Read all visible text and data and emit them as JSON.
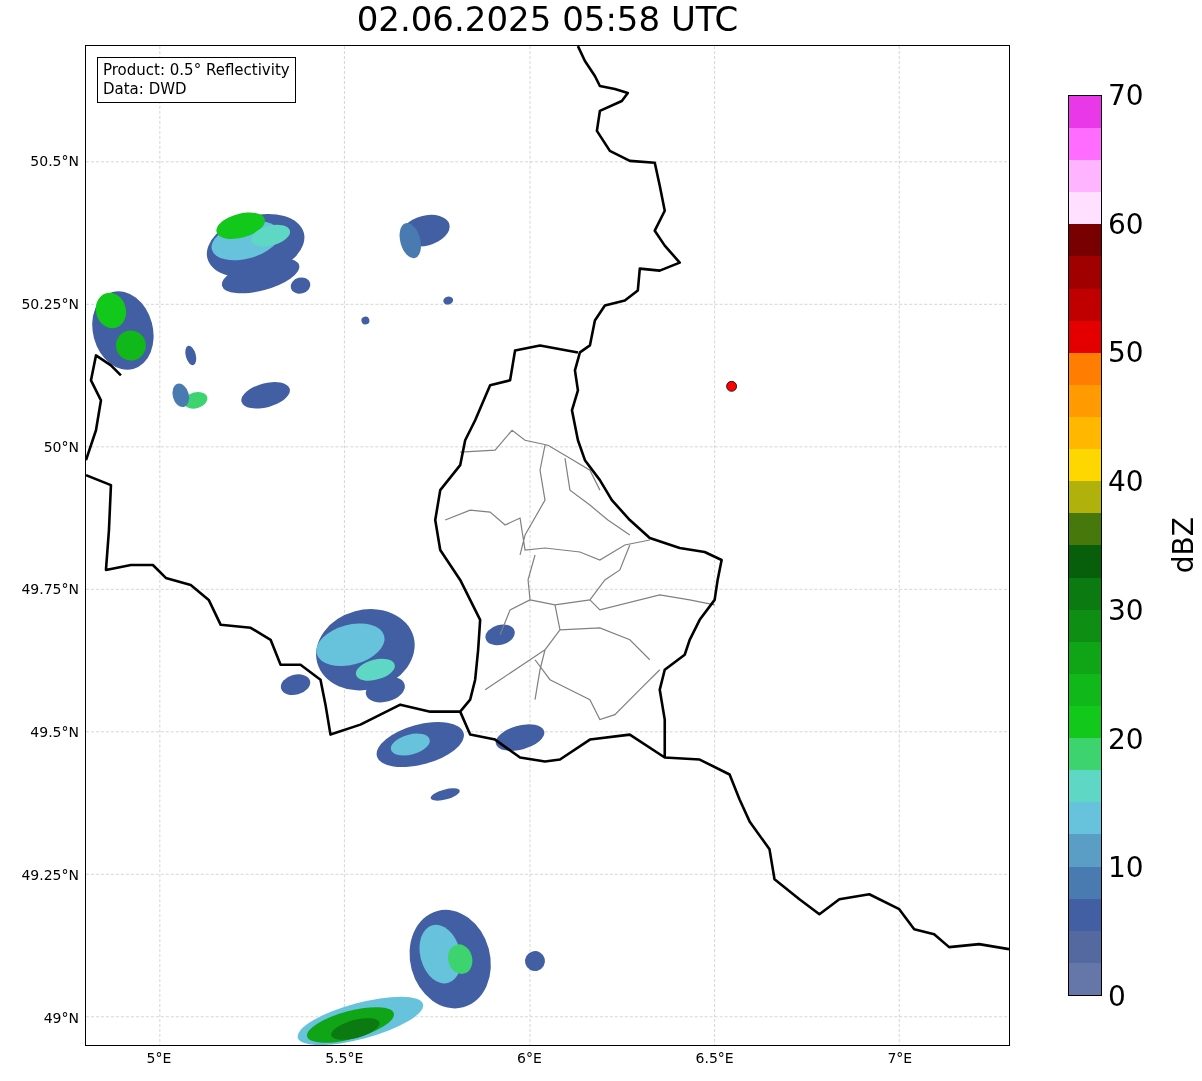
{
  "title": "02.06.2025 05:58 UTC",
  "map": {
    "legend": [
      "Product: 0.5° Reflectivity",
      "Data: DWD"
    ],
    "x_ticks": [
      "5°E",
      "5.5°E",
      "6°E",
      "6.5°E",
      "7°E"
    ],
    "y_ticks": [
      "50.5°N",
      "50.25°N",
      "50°N",
      "49.75°N",
      "49.5°N",
      "49.25°N",
      "49°N"
    ]
  },
  "colorbar": {
    "label": "dBZ",
    "ticks": [
      "70",
      "60",
      "50",
      "40",
      "30",
      "20",
      "10",
      "0"
    ],
    "segments": [
      {
        "color": "#6577a8"
      },
      {
        "color": "#54699f"
      },
      {
        "color": "#425fa3"
      },
      {
        "color": "#4a7bb0"
      },
      {
        "color": "#5a9ec6"
      },
      {
        "color": "#67c3dc"
      },
      {
        "color": "#5ed7c4"
      },
      {
        "color": "#3dd46f"
      },
      {
        "color": "#12c81a"
      },
      {
        "color": "#10b81a"
      },
      {
        "color": "#0fa516"
      },
      {
        "color": "#0e8f14"
      },
      {
        "color": "#0b7a11"
      },
      {
        "color": "#075f0c"
      },
      {
        "color": "#46780c"
      },
      {
        "color": "#b0b10a"
      },
      {
        "color": "#ffd700"
      },
      {
        "color": "#ffb700"
      },
      {
        "color": "#ff9b00"
      },
      {
        "color": "#ff7d00"
      },
      {
        "color": "#e50000"
      },
      {
        "color": "#c00000"
      },
      {
        "color": "#a00000"
      },
      {
        "color": "#780000"
      },
      {
        "color": "#ffe0ff"
      },
      {
        "color": "#ffb4ff"
      },
      {
        "color": "#ff6cff"
      },
      {
        "color": "#e838e8"
      }
    ]
  }
}
